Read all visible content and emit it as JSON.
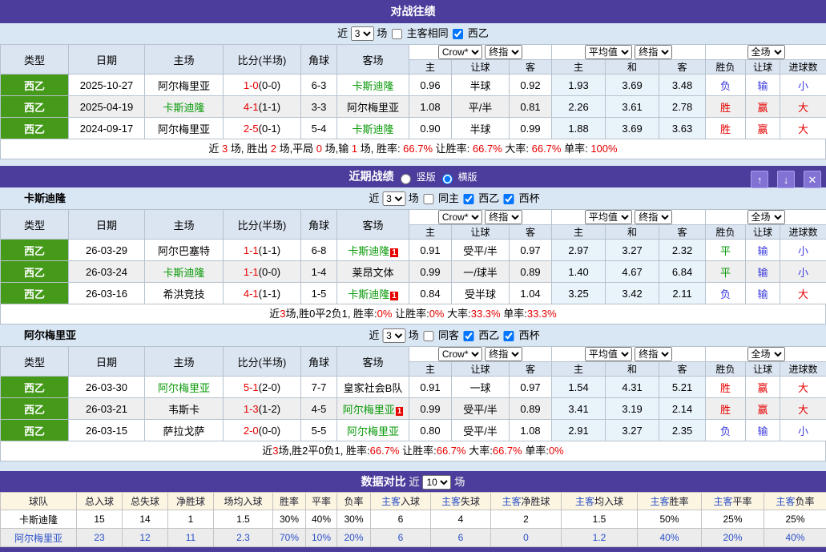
{
  "colors": {
    "purple": "#4c3c9c",
    "league_green": "#459a1a",
    "team_green": "#0a9a0a",
    "red": "#e60000",
    "blue": "#3b3bdf",
    "link_blue": "#2b50c8",
    "header_bg": "#dbe5f1",
    "odds_bg": "#e9f3fa"
  },
  "th": {
    "type": "类型",
    "date": "日期",
    "home": "主场",
    "score": "比分(半场)",
    "corner": "角球",
    "away": "客场",
    "sel_company": "Crow*",
    "sel_final": "终指",
    "sel_avg": "平均值",
    "sel_scope": "全场",
    "g1": [
      "主",
      "让球",
      "客"
    ],
    "g2": [
      "主",
      "和",
      "客"
    ],
    "g3": [
      "胜负",
      "让球",
      "进球数"
    ]
  },
  "h2h": {
    "title": "对战往绩",
    "filter": {
      "near": "近",
      "sel": "3",
      "games": "场",
      "cb1": "主客相同",
      "cb2": "西乙",
      "cb2_checked": "checked"
    },
    "rows": [
      {
        "lg": "西乙",
        "date": "2025-10-27",
        "home": "阿尔梅里亚",
        "homec": "",
        "sc": "1-0",
        "half": "(0-0)",
        "cor": "6-3",
        "away": "卡斯迪隆",
        "awayc": "green",
        "badge": "",
        "a1": "0.96",
        "a2": "半球",
        "a3": "0.92",
        "e1": "1.93",
        "e2": "3.69",
        "e3": "3.48",
        "r1": "负",
        "r1c": "blue",
        "r2": "输",
        "r2c": "blue",
        "r3": "小",
        "r3c": "blue"
      },
      {
        "lg": "西乙",
        "date": "2025-04-19",
        "home": "卡斯迪隆",
        "homec": "green",
        "sc": "4-1",
        "half": "(1-1)",
        "cor": "3-3",
        "away": "阿尔梅里亚",
        "awayc": "",
        "badge": "",
        "a1": "1.08",
        "a2": "平/半",
        "a3": "0.81",
        "e1": "2.26",
        "e2": "3.61",
        "e3": "2.78",
        "r1": "胜",
        "r1c": "red",
        "r2": "赢",
        "r2c": "red",
        "r3": "大",
        "r3c": "red"
      },
      {
        "lg": "西乙",
        "date": "2024-09-17",
        "home": "阿尔梅里亚",
        "homec": "",
        "sc": "2-5",
        "half": "(0-1)",
        "cor": "5-4",
        "away": "卡斯迪隆",
        "awayc": "green",
        "badge": "",
        "a1": "0.90",
        "a2": "半球",
        "a3": "0.99",
        "e1": "1.88",
        "e2": "3.69",
        "e3": "3.63",
        "r1": "胜",
        "r1c": "red",
        "r2": "赢",
        "r2c": "red",
        "r3": "大",
        "r3c": "red"
      }
    ],
    "summary": [
      {
        "t": "近 "
      },
      {
        "t": "3",
        "c": "red"
      },
      {
        "t": " 场, 胜出 "
      },
      {
        "t": "2",
        "c": "red"
      },
      {
        "t": " 场,平局 "
      },
      {
        "t": "0",
        "c": "red"
      },
      {
        "t": " 场,输 "
      },
      {
        "t": "1",
        "c": "red"
      },
      {
        "t": " 场, 胜率: "
      },
      {
        "t": "66.7%",
        "c": "red"
      },
      {
        "t": " 让胜率: "
      },
      {
        "t": "66.7%",
        "c": "red"
      },
      {
        "t": " 大率: "
      },
      {
        "t": "66.7%",
        "c": "red"
      },
      {
        "t": " 单率: "
      },
      {
        "t": "100%",
        "c": "red"
      }
    ]
  },
  "recent": {
    "title": "近期战绩",
    "radio1": "竖版",
    "radio2": "横版",
    "radio2_checked": "checked",
    "btn_up": "↑",
    "btn_down": "↓",
    "btn_close": "✕"
  },
  "team1": {
    "name": "卡斯迪隆",
    "filter": {
      "near": "近",
      "sel": "3",
      "games": "场",
      "cb1": "同主",
      "cb2": "西乙",
      "cb2_checked": "checked",
      "cb3": "西杯",
      "cb3_checked": "checked"
    },
    "rows": [
      {
        "lg": "西乙",
        "date": "26-03-29",
        "home": "阿尔巴塞特",
        "homec": "",
        "sc": "1-1",
        "half": "(1-1)",
        "cor": "6-8",
        "away": "卡斯迪隆",
        "awayc": "green",
        "badge": "1",
        "a1": "0.91",
        "a2": "受平/半",
        "a3": "0.97",
        "e1": "2.97",
        "e2": "3.27",
        "e3": "2.32",
        "r1": "平",
        "r1c": "green",
        "r2": "输",
        "r2c": "blue",
        "r3": "小",
        "r3c": "blue"
      },
      {
        "lg": "西乙",
        "date": "26-03-24",
        "home": "卡斯迪隆",
        "homec": "green",
        "sc": "1-1",
        "half": "(0-0)",
        "cor": "1-4",
        "away": "莱昂文体",
        "awayc": "",
        "badge": "",
        "a1": "0.99",
        "a2": "一/球半",
        "a3": "0.89",
        "e1": "1.40",
        "e2": "4.67",
        "e3": "6.84",
        "r1": "平",
        "r1c": "green",
        "r2": "输",
        "r2c": "blue",
        "r3": "小",
        "r3c": "blue"
      },
      {
        "lg": "西乙",
        "date": "26-03-16",
        "home": "希洪竞技",
        "homec": "",
        "sc": "4-1",
        "half": "(1-1)",
        "cor": "1-5",
        "away": "卡斯迪隆",
        "awayc": "green",
        "badge": "1",
        "a1": "0.84",
        "a2": "受半球",
        "a3": "1.04",
        "e1": "3.25",
        "e2": "3.42",
        "e3": "2.11",
        "r1": "负",
        "r1c": "blue",
        "r2": "输",
        "r2c": "blue",
        "r3": "大",
        "r3c": "red"
      }
    ],
    "summary": [
      {
        "t": "近"
      },
      {
        "t": "3",
        "c": "red"
      },
      {
        "t": "场,胜0平2负1, 胜率:"
      },
      {
        "t": "0%",
        "c": "red"
      },
      {
        "t": " 让胜率:"
      },
      {
        "t": "0%",
        "c": "red"
      },
      {
        "t": " 大率:"
      },
      {
        "t": "33.3%",
        "c": "red"
      },
      {
        "t": " 单率:"
      },
      {
        "t": "33.3%",
        "c": "red"
      }
    ]
  },
  "team2": {
    "name": "阿尔梅里亚",
    "filter": {
      "near": "近",
      "sel": "3",
      "games": "场",
      "cb1": "同客",
      "cb2": "西乙",
      "cb2_checked": "checked",
      "cb3": "西杯",
      "cb3_checked": "checked"
    },
    "rows": [
      {
        "lg": "西乙",
        "date": "26-03-30",
        "home": "阿尔梅里亚",
        "homec": "green",
        "sc": "5-1",
        "half": "(2-0)",
        "cor": "7-7",
        "away": "皇家社会B队",
        "awayc": "",
        "badge": "",
        "a1": "0.91",
        "a2": "一球",
        "a3": "0.97",
        "e1": "1.54",
        "e2": "4.31",
        "e3": "5.21",
        "r1": "胜",
        "r1c": "red",
        "r2": "赢",
        "r2c": "red",
        "r3": "大",
        "r3c": "red"
      },
      {
        "lg": "西乙",
        "date": "26-03-21",
        "home": "韦斯卡",
        "homec": "",
        "sc": "1-3",
        "half": "(1-2)",
        "cor": "4-5",
        "away": "阿尔梅里亚",
        "awayc": "green",
        "badge": "1",
        "a1": "0.99",
        "a2": "受平/半",
        "a3": "0.89",
        "e1": "3.41",
        "e2": "3.19",
        "e3": "2.14",
        "r1": "胜",
        "r1c": "red",
        "r2": "赢",
        "r2c": "red",
        "r3": "大",
        "r3c": "red"
      },
      {
        "lg": "西乙",
        "date": "26-03-15",
        "home": "萨拉戈萨",
        "homec": "",
        "sc": "2-0",
        "half": "(0-0)",
        "cor": "5-5",
        "away": "阿尔梅里亚",
        "awayc": "green",
        "badge": "",
        "a1": "0.80",
        "a2": "受平/半",
        "a3": "1.08",
        "e1": "2.91",
        "e2": "3.27",
        "e3": "2.35",
        "r1": "负",
        "r1c": "blue",
        "r2": "输",
        "r2c": "blue",
        "r3": "小",
        "r3c": "blue"
      }
    ],
    "summary": [
      {
        "t": "近"
      },
      {
        "t": "3",
        "c": "red"
      },
      {
        "t": "场,胜2平0负1, 胜率:"
      },
      {
        "t": "66.7%",
        "c": "red"
      },
      {
        "t": " 让胜率:"
      },
      {
        "t": "66.7%",
        "c": "red"
      },
      {
        "t": " 大率:"
      },
      {
        "t": "66.7%",
        "c": "red"
      },
      {
        "t": " 单率:"
      },
      {
        "t": "0%",
        "c": "red"
      }
    ]
  },
  "compare": {
    "title": "数据对比",
    "near": "近",
    "sel": "10",
    "games": "场",
    "headers": [
      [
        {
          "t": "球队"
        }
      ],
      [
        {
          "t": "总入球"
        }
      ],
      [
        {
          "t": "总失球"
        }
      ],
      [
        {
          "t": "净胜球"
        }
      ],
      [
        {
          "t": "场均入球"
        }
      ],
      [
        {
          "t": "胜率"
        }
      ],
      [
        {
          "t": "平率"
        }
      ],
      [
        {
          "t": "负率"
        }
      ],
      [
        {
          "t": "主客",
          "c": "blue2"
        },
        {
          "t": "入球"
        }
      ],
      [
        {
          "t": "主客",
          "c": "blue2"
        },
        {
          "t": "失球"
        }
      ],
      [
        {
          "t": "主客",
          "c": "blue2"
        },
        {
          "t": "净胜球"
        }
      ],
      [
        {
          "t": "主客",
          "c": "blue2"
        },
        {
          "t": "均入球"
        }
      ],
      [
        {
          "t": "主客",
          "c": "blue2"
        },
        {
          "t": "胜率"
        }
      ],
      [
        {
          "t": "主客",
          "c": "blue2"
        },
        {
          "t": "平率"
        }
      ],
      [
        {
          "t": "主客",
          "c": "blue2"
        },
        {
          "t": "负率"
        }
      ]
    ],
    "r1": [
      "卡斯迪隆",
      "15",
      "14",
      "1",
      "1.5",
      "30%",
      "40%",
      "30%",
      "6",
      "4",
      "2",
      "1.5",
      "50%",
      "25%",
      "25%"
    ],
    "r2": [
      "阿尔梅里亚",
      "23",
      "12",
      "11",
      "2.3",
      "70%",
      "10%",
      "20%",
      "6",
      "6",
      "0",
      "1.2",
      "40%",
      "20%",
      "40%"
    ]
  }
}
